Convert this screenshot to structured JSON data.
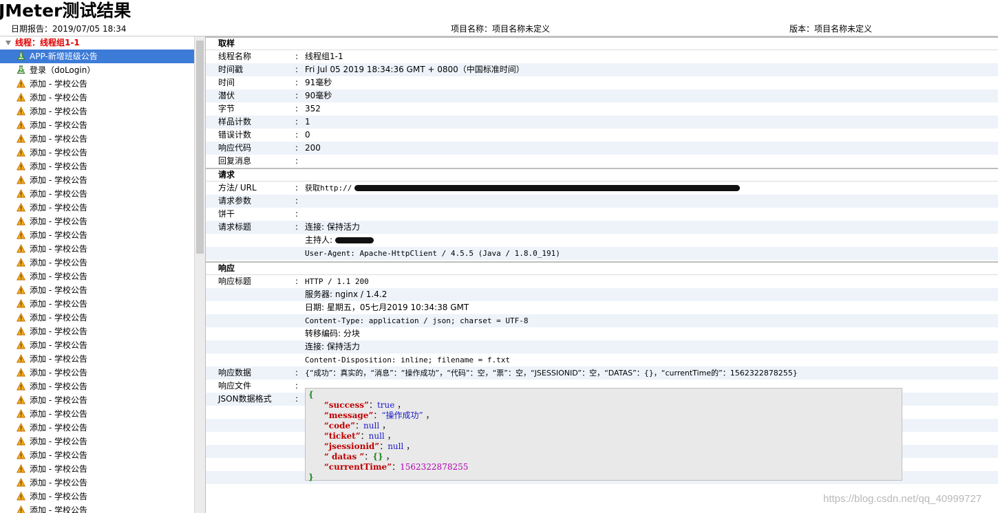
{
  "header": {
    "title": "JMeter测试结果",
    "report_date": "日期报告：2019/07/05 18:34",
    "project_name": "项目名称：项目名称未定义",
    "version": "版本：项目名称未定义"
  },
  "tree": {
    "group_label": "线程：线程组1-1",
    "items": [
      {
        "label": "APP-新增班级公告",
        "icon": "success-flask-icon",
        "selected": true
      },
      {
        "label": "登录（doLogin）",
        "icon": "success-flask-icon",
        "selected": false
      },
      {
        "label": "添加 - 学校公告",
        "icon": "warning-icon"
      },
      {
        "label": "添加 - 学校公告",
        "icon": "warning-icon"
      },
      {
        "label": "添加 - 学校公告",
        "icon": "warning-icon"
      },
      {
        "label": "添加 - 学校公告",
        "icon": "warning-icon"
      },
      {
        "label": "添加 - 学校公告",
        "icon": "warning-icon"
      },
      {
        "label": "添加 - 学校公告",
        "icon": "warning-icon"
      },
      {
        "label": "添加 - 学校公告",
        "icon": "warning-icon"
      },
      {
        "label": "添加 - 学校公告",
        "icon": "warning-icon"
      },
      {
        "label": "添加 - 学校公告",
        "icon": "warning-icon"
      },
      {
        "label": "添加 - 学校公告",
        "icon": "warning-icon"
      },
      {
        "label": "添加 - 学校公告",
        "icon": "warning-icon"
      },
      {
        "label": "添加 - 学校公告",
        "icon": "warning-icon"
      },
      {
        "label": "添加 - 学校公告",
        "icon": "warning-icon"
      },
      {
        "label": "添加 - 学校公告",
        "icon": "warning-icon"
      },
      {
        "label": "添加 - 学校公告",
        "icon": "warning-icon"
      },
      {
        "label": "添加 - 学校公告",
        "icon": "warning-icon"
      },
      {
        "label": "添加 - 学校公告",
        "icon": "warning-icon"
      },
      {
        "label": "添加 - 学校公告",
        "icon": "warning-icon"
      },
      {
        "label": "添加 - 学校公告",
        "icon": "warning-icon"
      },
      {
        "label": "添加 - 学校公告",
        "icon": "warning-icon"
      },
      {
        "label": "添加 - 学校公告",
        "icon": "warning-icon"
      },
      {
        "label": "添加 - 学校公告",
        "icon": "warning-icon"
      },
      {
        "label": "添加 - 学校公告",
        "icon": "warning-icon"
      },
      {
        "label": "添加 - 学校公告",
        "icon": "warning-icon"
      },
      {
        "label": "添加 - 学校公告",
        "icon": "warning-icon"
      },
      {
        "label": "添加 - 学校公告",
        "icon": "warning-icon"
      },
      {
        "label": "添加 - 学校公告",
        "icon": "warning-icon"
      },
      {
        "label": "添加 - 学校公告",
        "icon": "warning-icon"
      },
      {
        "label": "添加 - 学校公告",
        "icon": "warning-icon"
      },
      {
        "label": "添加 - 学校公告",
        "icon": "warning-icon"
      },
      {
        "label": "添加 - 学校公告",
        "icon": "warning-icon"
      },
      {
        "label": "添加 - 学校公告",
        "icon": "warning-icon"
      },
      {
        "label": "添加 - 学校公告",
        "icon": "warning-icon"
      }
    ]
  },
  "sample": {
    "heading": "取样",
    "rows": [
      {
        "key": "线程名称",
        "value": "线程组1-1"
      },
      {
        "key": "时间戳",
        "value": "Fri Jul 05 2019 18:34:36 GMT + 0800（中国标准时间）"
      },
      {
        "key": "时间",
        "value": "91毫秒"
      },
      {
        "key": "潜伏",
        "value": "90毫秒"
      },
      {
        "key": "字节",
        "value": "352"
      },
      {
        "key": "样品计数",
        "value": "1"
      },
      {
        "key": "错误计数",
        "value": "0"
      },
      {
        "key": "响应代码",
        "value": "200"
      },
      {
        "key": "回复消息",
        "value": ""
      }
    ]
  },
  "request": {
    "heading": "请求",
    "method_key": "方法/ URL",
    "method_value": "获取http://",
    "params_key": "请求参数",
    "cookie_key": "饼干",
    "headers_key": "请求标题",
    "header_lines": [
      "连接: 保持活力",
      "主持人: ",
      "User-Agent: Apache-HttpClient / 4.5.5 (Java / 1.8.0_191)"
    ]
  },
  "response": {
    "heading": "响应",
    "headers_key": "响应标题",
    "header_lines": [
      "HTTP / 1.1 200",
      "服务器: nginx / 1.4.2",
      "日期: 星期五，05七月2019 10:34:38 GMT",
      "Content-Type: application / json; charset = UTF-8",
      "转移编码: 分块",
      "连接: 保持活力",
      "Content-Disposition: inline; filename = f.txt"
    ],
    "data_key": "响应数据",
    "data_value": "{“成功”：真实的，“消息”：“操作成功”，“代码”：空，“票”：空，“JSESSIONID”：空，“DATAS”：{}，“currentTime的”：1562322878255}",
    "file_key": "响应文件",
    "json_key": "JSON数据格式",
    "json_lines": [
      {
        "k": "“success”",
        "sep": "：",
        "v": "true",
        "t": "kw",
        "end": "，"
      },
      {
        "k": "“message”",
        "sep": "：",
        "v": "“操作成功”",
        "t": "kw",
        "end": "，"
      },
      {
        "k": "“code”",
        "sep": "：",
        "v": "null",
        "t": "kw",
        "end": "，"
      },
      {
        "k": "“ticket”",
        "sep": "：",
        "v": "null",
        "t": "kw",
        "end": "，"
      },
      {
        "k": "“jsessionid”",
        "sep": "：",
        "v": "null",
        "t": "kw",
        "end": "，"
      },
      {
        "k": "“ datas ”",
        "sep": "：",
        "v": "{}",
        "t": "brace",
        "end": "，"
      },
      {
        "k": "“currentTime”",
        "sep": "：",
        "v": "1562322878255",
        "t": "num",
        "end": ""
      }
    ],
    "json_open": "{",
    "json_close": "}"
  },
  "watermark": "https://blog.csdn.net/qq_40999727",
  "colors": {
    "selected": "#3d7bd8",
    "group": "#e00000",
    "alt_row": "#eef3fa"
  }
}
